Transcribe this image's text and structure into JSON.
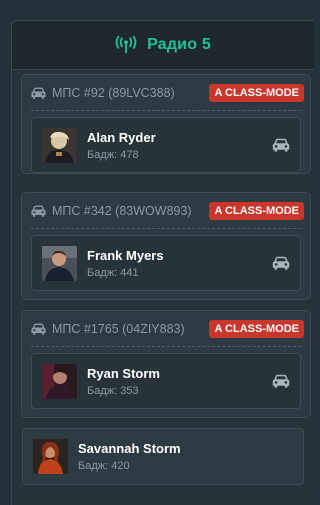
{
  "header": {
    "title": "Радио 5",
    "icon": "radio-tower-icon",
    "accent": "#22c193"
  },
  "units": [
    {
      "label": "МПС #92 (89LVC388)",
      "mode": "A CLASS-MODE",
      "members": [
        {
          "name": "Alan Ryder",
          "badge": "Бадж: 478"
        }
      ]
    },
    {
      "label": "МПС #342 (83WOW893)",
      "mode": "A CLASS-MODE",
      "members": [
        {
          "name": "Frank Myers",
          "badge": "Бадж: 441"
        }
      ]
    },
    {
      "label": "МПС #1765 (04ZIY883)",
      "mode": "A CLASS-MODE",
      "members": [
        {
          "name": "Ryan Storm",
          "badge": "Бадж: 353"
        }
      ]
    }
  ],
  "unassigned": [
    {
      "name": "Savannah Storm",
      "badge": "Бадж: 420"
    }
  ],
  "colors": {
    "mode_badge": "#c9372c",
    "background": "#263038"
  }
}
